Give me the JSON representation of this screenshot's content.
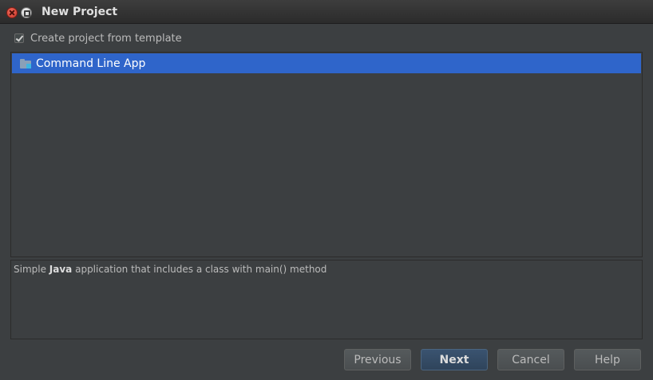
{
  "window": {
    "title": "New Project"
  },
  "template_checkbox": {
    "label": "Create project from template",
    "checked": true
  },
  "templates": [
    {
      "label": "Command Line App",
      "icon": "folder-module-icon",
      "selected": true
    }
  ],
  "description": {
    "prefix": "Simple ",
    "bold": "Java",
    "suffix": " application that includes a class with main() method"
  },
  "buttons": {
    "previous": "Previous",
    "next": "Next",
    "cancel": "Cancel",
    "help": "Help"
  },
  "colors": {
    "selection": "#2f65ca",
    "background": "#3c3f41"
  }
}
